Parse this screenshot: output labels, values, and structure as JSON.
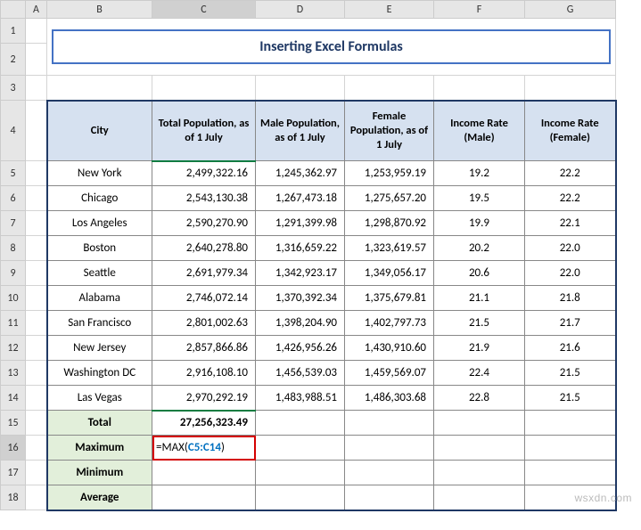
{
  "columns": [
    "A",
    "B",
    "C",
    "D",
    "E",
    "F",
    "G"
  ],
  "rows": [
    1,
    2,
    3,
    4,
    5,
    6,
    7,
    8,
    9,
    10,
    11,
    12,
    13,
    14,
    15,
    16,
    17,
    18
  ],
  "title": "Inserting Excel Formulas",
  "headers": {
    "city": "City",
    "total_pop": "Total Population, as of 1 July",
    "male_pop": "Male Population, as of 1 July",
    "female_pop": "Female Population, as of 1 July",
    "rate_m": "Income Rate (Male)",
    "rate_f": "Income Rate (Female)"
  },
  "data": [
    {
      "city": "New York",
      "tp": "2,499,322.16",
      "mp": "1,245,362.97",
      "fp": "1,253,959.19",
      "rm": "19.2",
      "rf": "22.2"
    },
    {
      "city": "Chicago",
      "tp": "2,543,130.38",
      "mp": "1,267,473.18",
      "fp": "1,275,657.20",
      "rm": "19.5",
      "rf": "22.2"
    },
    {
      "city": "Los Angeles",
      "tp": "2,590,270.90",
      "mp": "1,291,399.98",
      "fp": "1,298,870.92",
      "rm": "19.9",
      "rf": "22.1"
    },
    {
      "city": "Boston",
      "tp": "2,640,278.80",
      "mp": "1,316,659.22",
      "fp": "1,323,619.57",
      "rm": "20.2",
      "rf": "22.0"
    },
    {
      "city": "Seattle",
      "tp": "2,691,979.34",
      "mp": "1,342,923.17",
      "fp": "1,349,056.17",
      "rm": "20.6",
      "rf": "22.0"
    },
    {
      "city": "Alabama",
      "tp": "2,746,072.14",
      "mp": "1,370,392.34",
      "fp": "1,375,679.81",
      "rm": "21.1",
      "rf": "21.8"
    },
    {
      "city": "San Francisco",
      "tp": "2,801,002.63",
      "mp": "1,398,204.90",
      "fp": "1,402,797.73",
      "rm": "21.5",
      "rf": "21.7"
    },
    {
      "city": "New Jersey",
      "tp": "2,857,866.86",
      "mp": "1,426,956.26",
      "fp": "1,430,910.60",
      "rm": "21.9",
      "rf": "21.6"
    },
    {
      "city": "Washington DC",
      "tp": "2,916,108.10",
      "mp": "1,456,539.03",
      "fp": "1,459,569.07",
      "rm": "22.4",
      "rf": "21.5"
    },
    {
      "city": "Las Vegas",
      "tp": "2,970,292.19",
      "mp": "1,483,988.51",
      "fp": "1,486,303.68",
      "rm": "22.8",
      "rf": "21.5"
    }
  ],
  "summary": {
    "total_label": "Total",
    "total_value": "27,256,323.49",
    "max_label": "Maximum",
    "min_label": "Minimum",
    "avg_label": "Average"
  },
  "formula": {
    "prefix": "=MAX(",
    "ref": "C5:C14",
    "suffix": ")"
  },
  "chart_data": {
    "type": "table",
    "title": "Inserting Excel Formulas",
    "columns": [
      "City",
      "Total Population, as of 1 July",
      "Male Population, as of 1 July",
      "Female Population, as of 1 July",
      "Income Rate (Male)",
      "Income Rate (Female)"
    ],
    "rows": [
      [
        "New York",
        2499322.16,
        1245362.97,
        1253959.19,
        19.2,
        22.2
      ],
      [
        "Chicago",
        2543130.38,
        1267473.18,
        1275657.2,
        19.5,
        22.2
      ],
      [
        "Los Angeles",
        2590270.9,
        1291399.98,
        1298870.92,
        19.9,
        22.1
      ],
      [
        "Boston",
        2640278.8,
        1316659.22,
        1323619.57,
        20.2,
        22.0
      ],
      [
        "Seattle",
        2691979.34,
        1342923.17,
        1349056.17,
        20.6,
        22.0
      ],
      [
        "Alabama",
        2746072.14,
        1370392.34,
        1375679.81,
        21.1,
        21.8
      ],
      [
        "San Francisco",
        2801002.63,
        1398204.9,
        1402797.73,
        21.5,
        21.7
      ],
      [
        "New Jersey",
        2857866.86,
        1426956.26,
        1430910.6,
        21.9,
        21.6
      ],
      [
        "Washington DC",
        2916108.1,
        1456539.03,
        1459569.07,
        22.4,
        21.5
      ],
      [
        "Las Vegas",
        2970292.19,
        1483988.51,
        1486303.68,
        22.8,
        21.5
      ]
    ],
    "totals": {
      "Total Population": 27256323.49
    }
  },
  "watermark": "wsxdn.com"
}
